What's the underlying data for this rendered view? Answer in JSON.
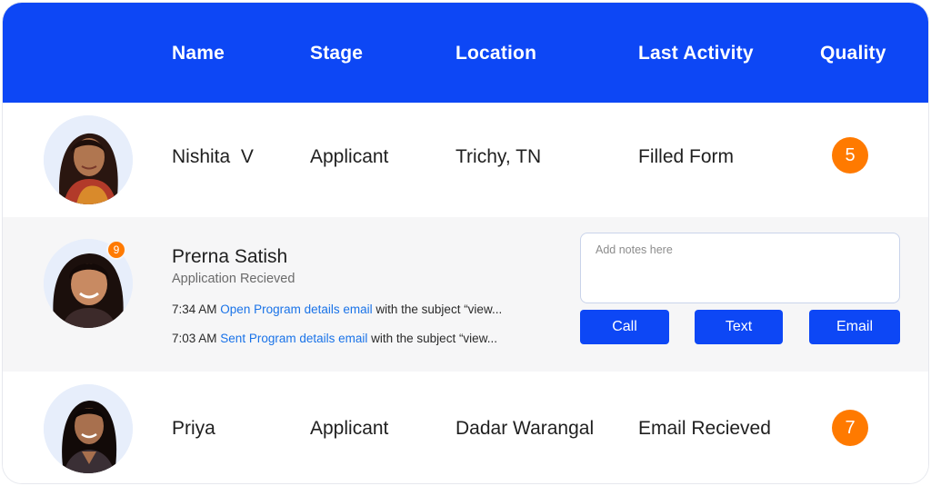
{
  "header": {
    "columns": [
      "Name",
      "Stage",
      "Location",
      "Last Activity",
      "Quality"
    ]
  },
  "rows": [
    {
      "name": "Nishita  V",
      "stage": "Applicant",
      "location": "Trichy, TN",
      "last_activity": "Filled Form",
      "quality": "5"
    },
    {
      "name": "Priya",
      "stage": "Applicant",
      "location": "Dadar Warangal",
      "last_activity": "Email Recieved",
      "quality": "7"
    }
  ],
  "expanded": {
    "name": "Prerna Satish",
    "status": "Application Recieved",
    "badge_count": "9",
    "activities": [
      {
        "time": "7:34 AM",
        "action": "Open Program details email",
        "rest": "with the subject “view..."
      },
      {
        "time": "7:03 AM",
        "action": "Sent Program details email",
        "rest": "with the subject “view..."
      }
    ],
    "notes_placeholder": "Add notes here",
    "buttons": {
      "call": "Call",
      "text": "Text",
      "email": "Email"
    }
  },
  "colors": {
    "header_bg": "#0d47f5",
    "button_bg": "#0d47f5",
    "quality_badge": "#ff7a00",
    "link": "#1a73e8",
    "expanded_row_bg": "#f6f6f7"
  },
  "icons": {
    "avatar_1": "avatar-photo-woman-icon",
    "avatar_2": "avatar-photo-woman-icon",
    "avatar_3": "avatar-photo-woman-icon"
  }
}
